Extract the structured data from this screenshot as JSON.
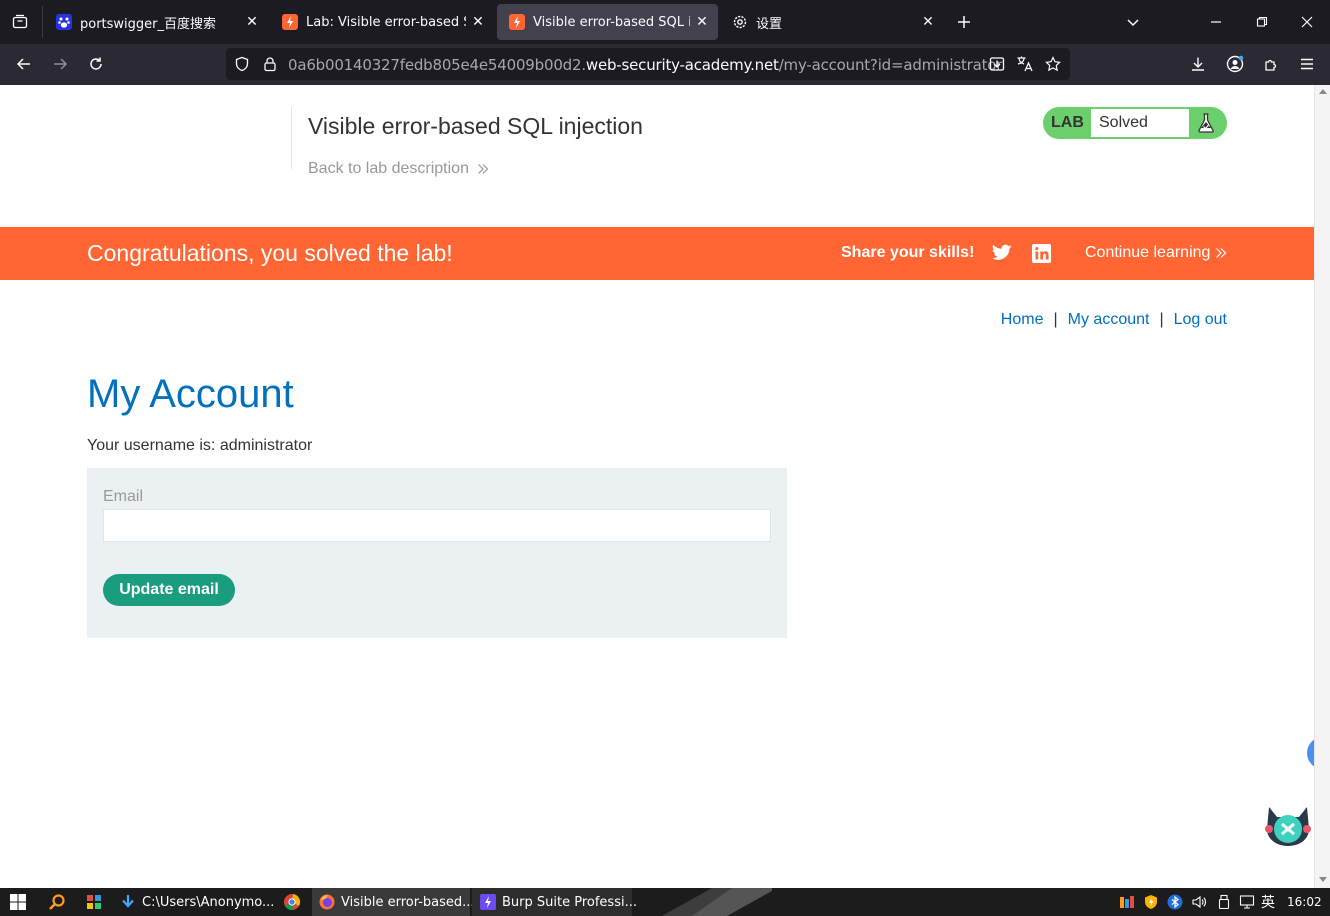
{
  "browser": {
    "tabs": [
      {
        "title": "portswigger_百度搜索",
        "active": false
      },
      {
        "title": "Lab: Visible error-based SQL i",
        "active": false
      },
      {
        "title": "Visible error-based SQL inject",
        "active": true
      },
      {
        "title": "设置",
        "active": false
      }
    ],
    "url_prefix": "0a6b00140327fedb805e4e54009b00d2.",
    "url_domain": "web-security-academy.net",
    "url_path": "/my-account?id=administrator"
  },
  "lab": {
    "title": "Visible error-based SQL injection",
    "back_link": "Back to lab description",
    "badge_label": "LAB",
    "status": "Solved"
  },
  "banner": {
    "message": "Congratulations, you solved the lab!",
    "share": "Share your skills!",
    "continue": "Continue learning"
  },
  "topnav": {
    "home": "Home",
    "sep": "|",
    "my_account": "My account",
    "logout": "Log out"
  },
  "account": {
    "heading": "My Account",
    "username_text": "Your username is: administrator",
    "email_label": "Email",
    "email_value": "",
    "update_button": "Update email"
  },
  "taskbar": {
    "items": [
      {
        "label": "C:\\Users\\Anonymo..."
      },
      {
        "label": "Visible error-based..."
      },
      {
        "label": "Burp Suite Professi..."
      }
    ],
    "ime": "英",
    "clock": "16:02"
  },
  "colors": {
    "accent_orange": "#ff6633",
    "link_blue": "#0071bc",
    "solved_green": "#6bd06b",
    "button_teal": "#1a9c7e"
  }
}
